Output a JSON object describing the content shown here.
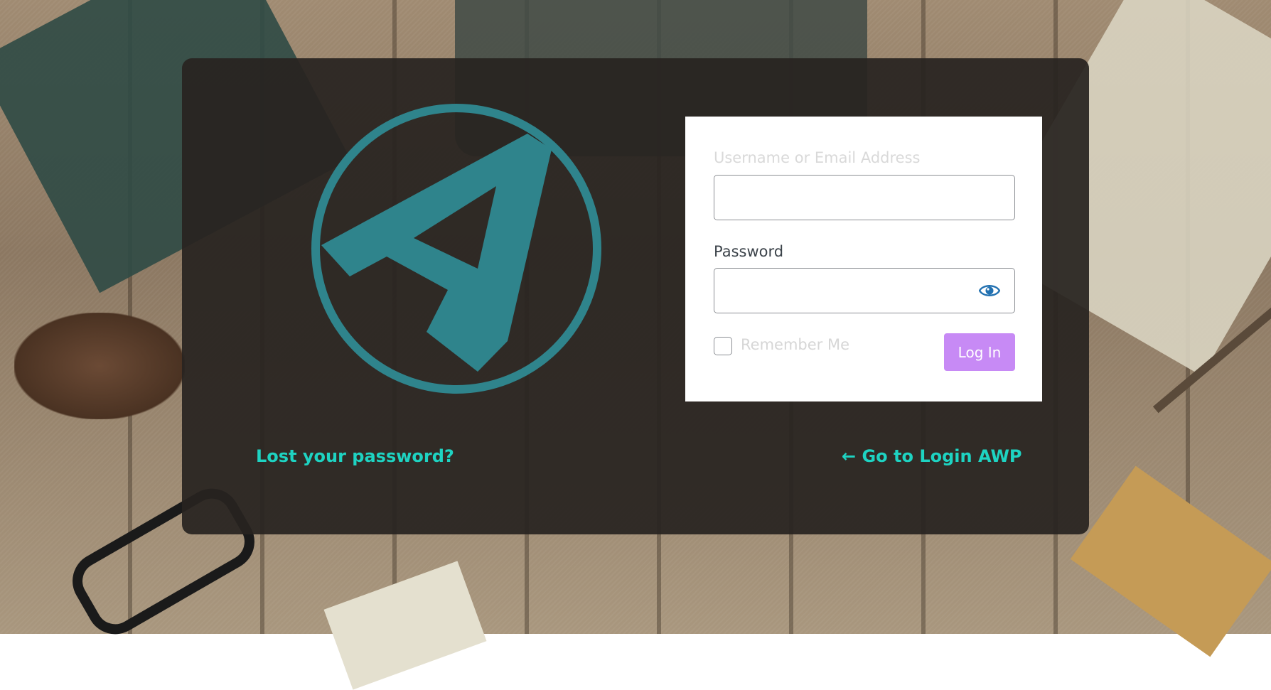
{
  "colors": {
    "accent_teal": "#2f848c",
    "link_color": "#1ed3c2",
    "button_bg": "#c78af5",
    "panel_bg": "rgba(40,36,32,0.93)"
  },
  "logo": {
    "icon": "letter-a-circle-logo"
  },
  "form": {
    "username_label": "Username or Email Address",
    "username_value": "",
    "password_label": "Password",
    "password_value": "",
    "show_password_icon": "eye-icon",
    "remember_label": "Remember Me",
    "remember_checked": false,
    "submit_label": "Log In"
  },
  "links": {
    "lost_password": "Lost your password?",
    "back_to_site": "← Go to Login AWP"
  }
}
